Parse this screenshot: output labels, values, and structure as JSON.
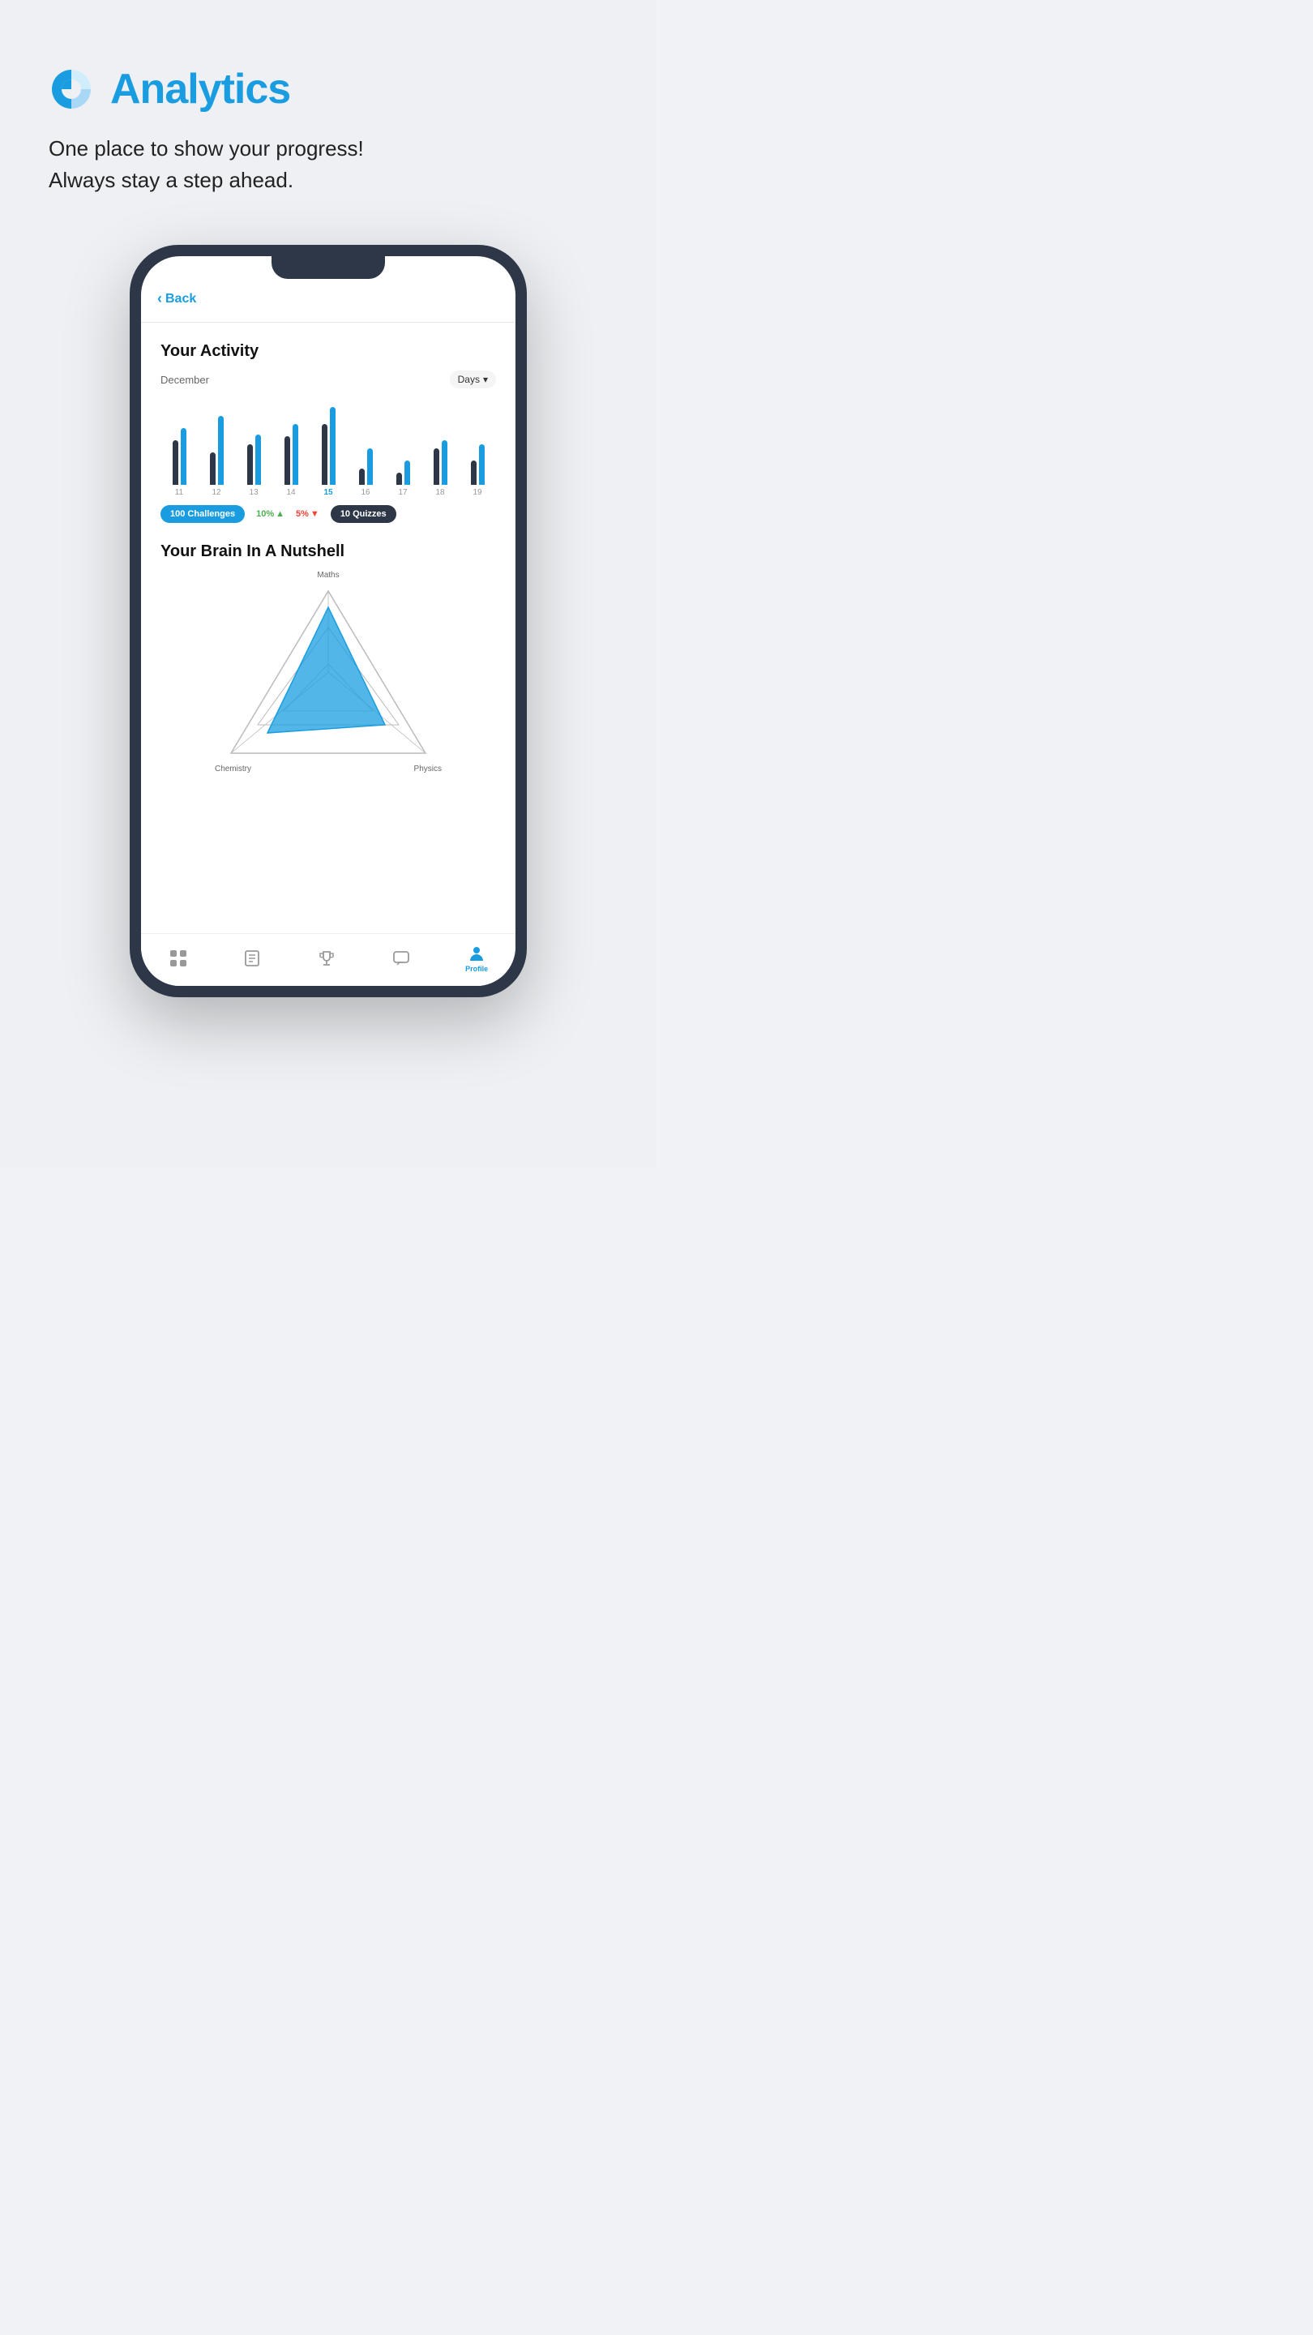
{
  "page": {
    "background_color": "#eef0f3"
  },
  "header": {
    "icon_name": "analytics-pie-icon",
    "title": "Analytics",
    "subtitle_line1": "One place to show your progress!",
    "subtitle_line2": "Always stay a step ahead."
  },
  "phone": {
    "back_button_label": "Back",
    "activity_section": {
      "title": "Your Activity",
      "month": "December",
      "period_selector": "Days",
      "bars": [
        {
          "day": "11",
          "dark_height": 55,
          "blue_height": 70,
          "active": false
        },
        {
          "day": "12",
          "dark_height": 40,
          "blue_height": 85,
          "active": false
        },
        {
          "day": "13",
          "dark_height": 50,
          "blue_height": 60,
          "active": false
        },
        {
          "day": "14",
          "dark_height": 60,
          "blue_height": 75,
          "active": false
        },
        {
          "day": "15",
          "dark_height": 75,
          "blue_height": 95,
          "active": true
        },
        {
          "day": "16",
          "dark_height": 30,
          "blue_height": 45,
          "active": false
        },
        {
          "day": "17",
          "dark_height": 25,
          "blue_height": 35,
          "active": false
        },
        {
          "day": "18",
          "dark_height": 45,
          "blue_height": 55,
          "active": false
        },
        {
          "day": "19",
          "dark_height": 35,
          "blue_height": 50,
          "active": false
        }
      ],
      "stats": [
        {
          "type": "badge_blue",
          "value": "100 Challenges"
        },
        {
          "type": "stat_green",
          "value": "10%",
          "arrow": "▲"
        },
        {
          "type": "stat_red",
          "value": "5%",
          "arrow": "▼"
        },
        {
          "type": "badge_dark",
          "value": "10 Quizzes"
        }
      ]
    },
    "brain_section": {
      "title": "Your Brain In A Nutshell",
      "labels": {
        "top": "Maths",
        "bottom_left": "Chemistry",
        "bottom_right": "Physics"
      }
    },
    "bottom_nav": [
      {
        "icon": "home-grid-icon",
        "label": "",
        "active": false
      },
      {
        "icon": "book-icon",
        "label": "",
        "active": false
      },
      {
        "icon": "trophy-icon",
        "label": "",
        "active": false
      },
      {
        "icon": "chat-icon",
        "label": "",
        "active": false
      },
      {
        "icon": "profile-icon",
        "label": "Profile",
        "active": true
      }
    ]
  }
}
